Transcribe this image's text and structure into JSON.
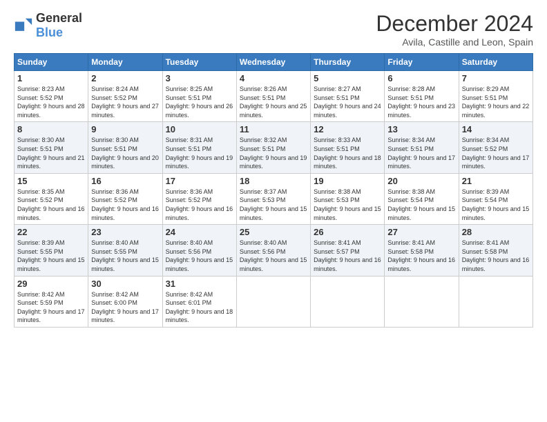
{
  "header": {
    "logo_general": "General",
    "logo_blue": "Blue",
    "title": "December 2024",
    "location": "Avila, Castille and Leon, Spain"
  },
  "columns": [
    "Sunday",
    "Monday",
    "Tuesday",
    "Wednesday",
    "Thursday",
    "Friday",
    "Saturday"
  ],
  "weeks": [
    [
      {
        "day": "1",
        "sunrise": "Sunrise: 8:23 AM",
        "sunset": "Sunset: 5:52 PM",
        "daylight": "Daylight: 9 hours and 28 minutes."
      },
      {
        "day": "2",
        "sunrise": "Sunrise: 8:24 AM",
        "sunset": "Sunset: 5:52 PM",
        "daylight": "Daylight: 9 hours and 27 minutes."
      },
      {
        "day": "3",
        "sunrise": "Sunrise: 8:25 AM",
        "sunset": "Sunset: 5:51 PM",
        "daylight": "Daylight: 9 hours and 26 minutes."
      },
      {
        "day": "4",
        "sunrise": "Sunrise: 8:26 AM",
        "sunset": "Sunset: 5:51 PM",
        "daylight": "Daylight: 9 hours and 25 minutes."
      },
      {
        "day": "5",
        "sunrise": "Sunrise: 8:27 AM",
        "sunset": "Sunset: 5:51 PM",
        "daylight": "Daylight: 9 hours and 24 minutes."
      },
      {
        "day": "6",
        "sunrise": "Sunrise: 8:28 AM",
        "sunset": "Sunset: 5:51 PM",
        "daylight": "Daylight: 9 hours and 23 minutes."
      },
      {
        "day": "7",
        "sunrise": "Sunrise: 8:29 AM",
        "sunset": "Sunset: 5:51 PM",
        "daylight": "Daylight: 9 hours and 22 minutes."
      }
    ],
    [
      {
        "day": "8",
        "sunrise": "Sunrise: 8:30 AM",
        "sunset": "Sunset: 5:51 PM",
        "daylight": "Daylight: 9 hours and 21 minutes."
      },
      {
        "day": "9",
        "sunrise": "Sunrise: 8:30 AM",
        "sunset": "Sunset: 5:51 PM",
        "daylight": "Daylight: 9 hours and 20 minutes."
      },
      {
        "day": "10",
        "sunrise": "Sunrise: 8:31 AM",
        "sunset": "Sunset: 5:51 PM",
        "daylight": "Daylight: 9 hours and 19 minutes."
      },
      {
        "day": "11",
        "sunrise": "Sunrise: 8:32 AM",
        "sunset": "Sunset: 5:51 PM",
        "daylight": "Daylight: 9 hours and 19 minutes."
      },
      {
        "day": "12",
        "sunrise": "Sunrise: 8:33 AM",
        "sunset": "Sunset: 5:51 PM",
        "daylight": "Daylight: 9 hours and 18 minutes."
      },
      {
        "day": "13",
        "sunrise": "Sunrise: 8:34 AM",
        "sunset": "Sunset: 5:51 PM",
        "daylight": "Daylight: 9 hours and 17 minutes."
      },
      {
        "day": "14",
        "sunrise": "Sunrise: 8:34 AM",
        "sunset": "Sunset: 5:52 PM",
        "daylight": "Daylight: 9 hours and 17 minutes."
      }
    ],
    [
      {
        "day": "15",
        "sunrise": "Sunrise: 8:35 AM",
        "sunset": "Sunset: 5:52 PM",
        "daylight": "Daylight: 9 hours and 16 minutes."
      },
      {
        "day": "16",
        "sunrise": "Sunrise: 8:36 AM",
        "sunset": "Sunset: 5:52 PM",
        "daylight": "Daylight: 9 hours and 16 minutes."
      },
      {
        "day": "17",
        "sunrise": "Sunrise: 8:36 AM",
        "sunset": "Sunset: 5:52 PM",
        "daylight": "Daylight: 9 hours and 16 minutes."
      },
      {
        "day": "18",
        "sunrise": "Sunrise: 8:37 AM",
        "sunset": "Sunset: 5:53 PM",
        "daylight": "Daylight: 9 hours and 15 minutes."
      },
      {
        "day": "19",
        "sunrise": "Sunrise: 8:38 AM",
        "sunset": "Sunset: 5:53 PM",
        "daylight": "Daylight: 9 hours and 15 minutes."
      },
      {
        "day": "20",
        "sunrise": "Sunrise: 8:38 AM",
        "sunset": "Sunset: 5:54 PM",
        "daylight": "Daylight: 9 hours and 15 minutes."
      },
      {
        "day": "21",
        "sunrise": "Sunrise: 8:39 AM",
        "sunset": "Sunset: 5:54 PM",
        "daylight": "Daylight: 9 hours and 15 minutes."
      }
    ],
    [
      {
        "day": "22",
        "sunrise": "Sunrise: 8:39 AM",
        "sunset": "Sunset: 5:55 PM",
        "daylight": "Daylight: 9 hours and 15 minutes."
      },
      {
        "day": "23",
        "sunrise": "Sunrise: 8:40 AM",
        "sunset": "Sunset: 5:55 PM",
        "daylight": "Daylight: 9 hours and 15 minutes."
      },
      {
        "day": "24",
        "sunrise": "Sunrise: 8:40 AM",
        "sunset": "Sunset: 5:56 PM",
        "daylight": "Daylight: 9 hours and 15 minutes."
      },
      {
        "day": "25",
        "sunrise": "Sunrise: 8:40 AM",
        "sunset": "Sunset: 5:56 PM",
        "daylight": "Daylight: 9 hours and 15 minutes."
      },
      {
        "day": "26",
        "sunrise": "Sunrise: 8:41 AM",
        "sunset": "Sunset: 5:57 PM",
        "daylight": "Daylight: 9 hours and 16 minutes."
      },
      {
        "day": "27",
        "sunrise": "Sunrise: 8:41 AM",
        "sunset": "Sunset: 5:58 PM",
        "daylight": "Daylight: 9 hours and 16 minutes."
      },
      {
        "day": "28",
        "sunrise": "Sunrise: 8:41 AM",
        "sunset": "Sunset: 5:58 PM",
        "daylight": "Daylight: 9 hours and 16 minutes."
      }
    ],
    [
      {
        "day": "29",
        "sunrise": "Sunrise: 8:42 AM",
        "sunset": "Sunset: 5:59 PM",
        "daylight": "Daylight: 9 hours and 17 minutes."
      },
      {
        "day": "30",
        "sunrise": "Sunrise: 8:42 AM",
        "sunset": "Sunset: 6:00 PM",
        "daylight": "Daylight: 9 hours and 17 minutes."
      },
      {
        "day": "31",
        "sunrise": "Sunrise: 8:42 AM",
        "sunset": "Sunset: 6:01 PM",
        "daylight": "Daylight: 9 hours and 18 minutes."
      },
      null,
      null,
      null,
      null
    ]
  ]
}
